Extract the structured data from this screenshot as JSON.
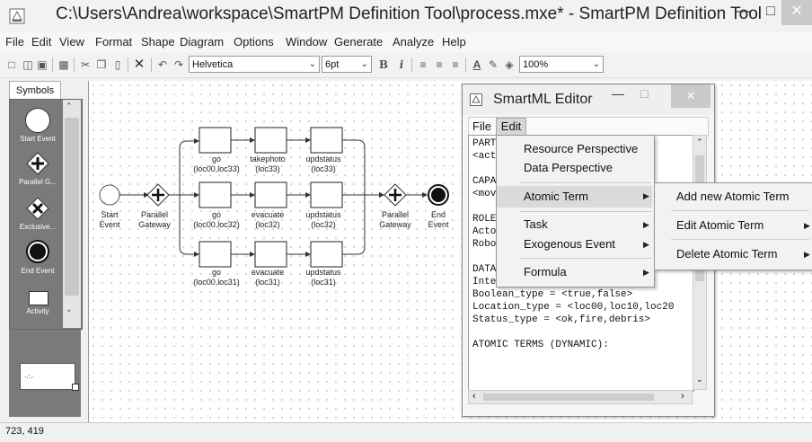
{
  "window": {
    "title": "C:\\Users\\Andrea\\workspace\\SmartPM Definition Tool\\process.mxe* - SmartPM Definition Tool"
  },
  "menubar": [
    "File",
    "Edit",
    "View",
    "Format",
    "Shape",
    "Diagram",
    "Options",
    "Window",
    "Generate",
    "Analyze",
    "Help"
  ],
  "toolbar": {
    "font": "Helvetica",
    "size": "6pt",
    "zoom": "100%"
  },
  "palette": {
    "tab": "Symbols",
    "items": [
      "Start Event",
      "Parallel G...",
      "Exclusive...",
      "End Event",
      "Activity"
    ]
  },
  "diagram": {
    "start": {
      "l1": "Start",
      "l2": "Event"
    },
    "split": {
      "l1": "Parallel",
      "l2": "Gateway"
    },
    "join": {
      "l1": "Parallel",
      "l2": "Gateway"
    },
    "end": {
      "l1": "End",
      "l2": "Event"
    },
    "rows": [
      {
        "tasks": [
          {
            "l1": "go",
            "l2": "(loc00,loc33)"
          },
          {
            "l1": "takephoto",
            "l2": "(loc33)"
          },
          {
            "l1": "updstatus",
            "l2": "(loc33)"
          }
        ]
      },
      {
        "tasks": [
          {
            "l1": "go",
            "l2": "(loc00,loc32)"
          },
          {
            "l1": "evacuate",
            "l2": "(loc32)"
          },
          {
            "l1": "updstatus",
            "l2": "(loc32)"
          }
        ]
      },
      {
        "tasks": [
          {
            "l1": "go",
            "l2": "(loc00,loc31)"
          },
          {
            "l1": "evacuate",
            "l2": "(loc31)"
          },
          {
            "l1": "updstatus",
            "l2": "(loc31)"
          }
        ]
      }
    ]
  },
  "editor": {
    "title": "SmartML Editor",
    "menu": [
      "File",
      "Edit"
    ],
    "lines": [
      "PART",
      "<act                    >",
      "",
      "CAPA",
      "<mov",
      "",
      "ROLE",
      "Acto",
      "Robo",
      "",
      "DATA TYPES:",
      "Integer_type = <0..30>",
      "Boolean_type = <true,false>",
      "Location_type = <loc00,loc10,loc20",
      "Status_type = <ok,fire,debris>",
      "",
      "ATOMIC TERMS (DYNAMIC):"
    ]
  },
  "edit_menu": {
    "items": [
      "Resource Perspective",
      "Data Perspective",
      "Atomic Term",
      "Task",
      "Exogenous Event",
      "Formula"
    ]
  },
  "atomic_menu": {
    "items": [
      "Add new Atomic Term",
      "Edit Atomic Term",
      "Delete Atomic Term"
    ]
  },
  "status": {
    "coords": "723, 419"
  },
  "colors": {
    "palette_bg": "#7a7a7a",
    "highlight": "#dadada",
    "close_btn": "#c9c9c9"
  }
}
